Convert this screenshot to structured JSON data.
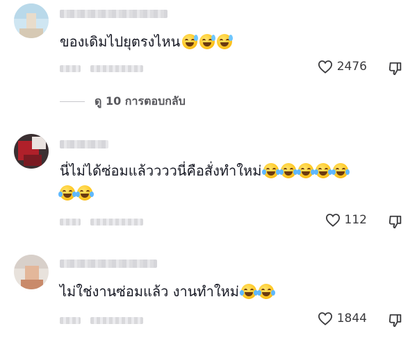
{
  "comments": [
    {
      "text": "ของเดิมไปยุตรงไหน",
      "emojis": [
        "sweat-smile-emoji",
        "sweat-smile-emoji",
        "sweat-smile-emoji"
      ],
      "likes": "2476"
    },
    {
      "text": "นี่ไม่ได้ซ่อมแล้ววววนี่คือสั่งทำใหม่",
      "emojis": [
        "tears-of-joy-emoji",
        "tears-of-joy-emoji",
        "tears-of-joy-emoji",
        "tears-of-joy-emoji",
        "tears-of-joy-emoji",
        "tears-of-joy-emoji",
        "tears-of-joy-emoji"
      ],
      "likes": "112"
    },
    {
      "text": "ไม่ใช่งานซ่อมแล้ว งานทำใหม่",
      "emojis": [
        "tears-of-joy-emoji",
        "tears-of-joy-emoji"
      ],
      "likes": "1844"
    }
  ],
  "view_replies_label": "ดู 10 การตอบกลับ",
  "icons": {
    "like": "heart-outline-icon",
    "dislike": "thumbs-down-outline-icon"
  },
  "colors": {
    "text": "#161823",
    "secondary": "#57575c",
    "emoji": "#ffc928"
  }
}
